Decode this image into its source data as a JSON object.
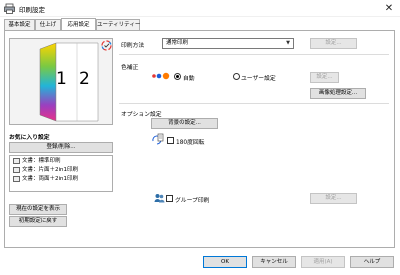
{
  "window": {
    "title": "印刷設定",
    "close_glyph": "✕"
  },
  "tabs": [
    {
      "label": "基本設定"
    },
    {
      "label": "仕上げ"
    },
    {
      "label": "応用設定"
    },
    {
      "label": "ユーティリティー"
    }
  ],
  "preview": {
    "page1": "1",
    "page2": "2"
  },
  "favorites": {
    "heading": "お気に入り設定",
    "register_button": "登録/削除...",
    "items": [
      {
        "label": "文書：標準印刷"
      },
      {
        "label": "文書：片面＋2in1印刷"
      },
      {
        "label": "文書：両面＋2in1印刷"
      }
    ],
    "show_current_button": "現在の設定を表示",
    "reset_button": "初期設定に戻す"
  },
  "print_method": {
    "label": "印刷方法",
    "value": "通常印刷",
    "settings_button": "設定..."
  },
  "color_correction": {
    "label": "色補正",
    "auto_label": "自動",
    "user_label": "ユーザー設定",
    "settings_button": "設定...",
    "image_processing_button": "画像処理設定..."
  },
  "options": {
    "label": "オプション設定",
    "background_button": "背景の設定...",
    "rotate_label": "180度回転",
    "group_label": "グループ印刷",
    "group_settings_button": "設定..."
  },
  "footer": {
    "ok": "OK",
    "cancel": "キャンセル",
    "apply": "適用(A)",
    "help": "ヘルプ"
  },
  "colors": {
    "accent": "#0078d7",
    "color_dot_1": "#e53935",
    "color_dot_2": "#1e5fd8",
    "color_dot_3": "#ff7b00"
  }
}
